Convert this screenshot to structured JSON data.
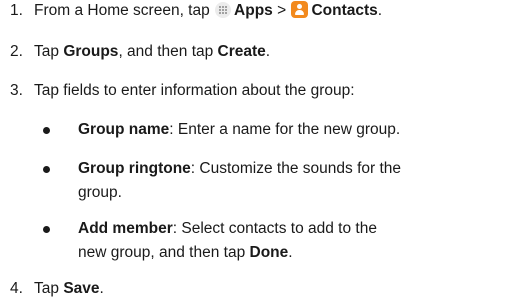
{
  "steps": [
    {
      "number": "1.",
      "parts": {
        "a": "From a Home screen, tap ",
        "apps": "Apps",
        "sep": " > ",
        "contacts": "Contacts",
        "end": "."
      }
    },
    {
      "number": "2.",
      "parts": {
        "a": "Tap ",
        "groups": "Groups",
        "b": ", and then tap ",
        "create": "Create",
        "end": "."
      }
    },
    {
      "number": "3.",
      "text": "Tap fields to enter information about the group:",
      "bullets": [
        {
          "term": "Group name",
          "desc": ": Enter a name for the new group."
        },
        {
          "term": "Group ringtone",
          "desc_line1": ": Customize the sounds for the",
          "desc_line2": "group."
        },
        {
          "term": "Add member",
          "desc_line1": ": Select contacts to add to the",
          "desc_line2a": "new group, and then tap ",
          "done": "Done",
          "end": "."
        }
      ]
    },
    {
      "number": "4.",
      "parts": {
        "a": "Tap ",
        "save": "Save",
        "end": "."
      }
    }
  ],
  "icons": {
    "apps_icon": "apps-grid-icon",
    "contacts_icon": "contacts-person-icon",
    "contacts_color": "#f28a1e"
  }
}
